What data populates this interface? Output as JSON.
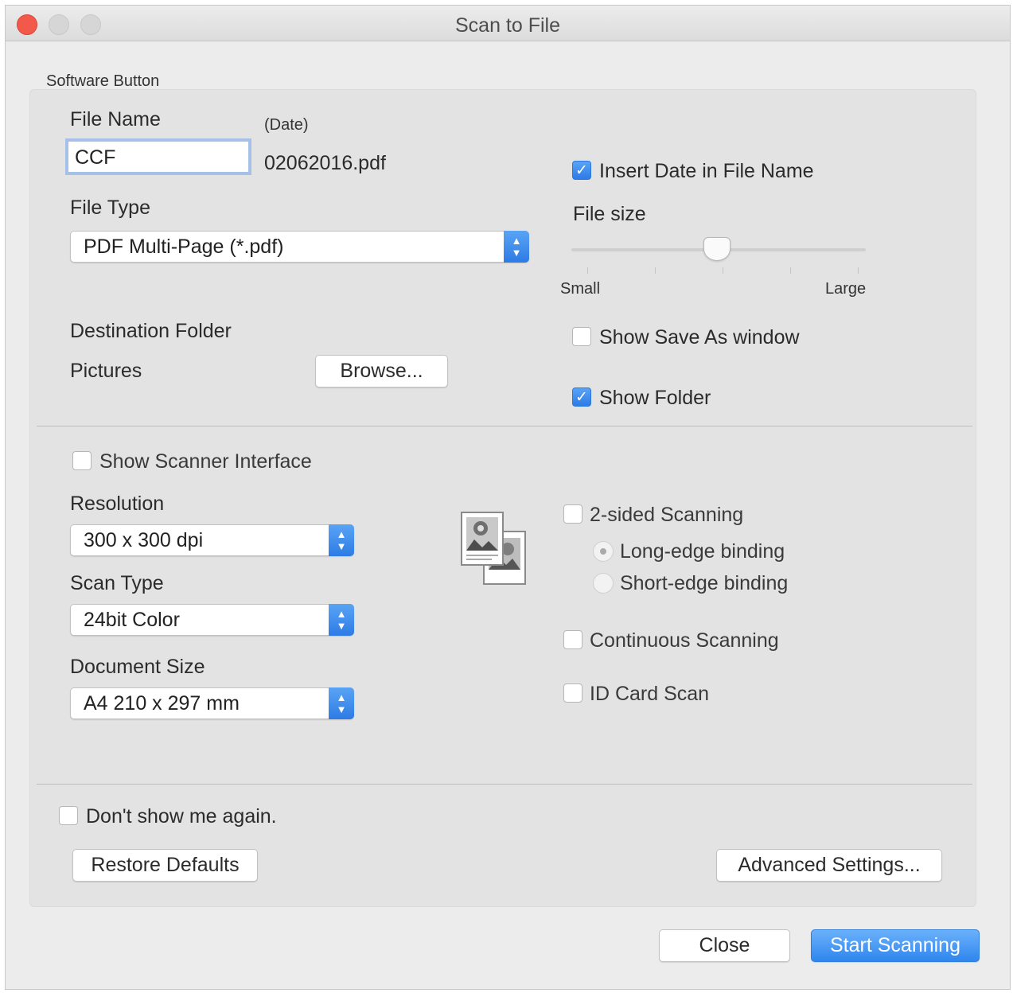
{
  "window": {
    "title": "Scan to File"
  },
  "group": {
    "label": "Software Button"
  },
  "file_name": {
    "label": "File Name",
    "date_label": "(Date)",
    "value": "CCF",
    "suffix": "02062016.pdf"
  },
  "insert_date": {
    "label": "Insert Date in File Name",
    "checked": true
  },
  "file_type": {
    "label": "File Type",
    "selected": "PDF Multi-Page (*.pdf)"
  },
  "file_size": {
    "label": "File size",
    "min_label": "Small",
    "max_label": "Large",
    "level": 0.5
  },
  "destination": {
    "label": "Destination Folder",
    "folder": "Pictures",
    "browse_label": "Browse..."
  },
  "show_save_as": {
    "label": "Show Save As window",
    "checked": false
  },
  "show_folder": {
    "label": "Show Folder",
    "checked": true
  },
  "show_scanner_interface": {
    "label": "Show Scanner Interface",
    "checked": false
  },
  "resolution": {
    "label": "Resolution",
    "selected": "300 x 300 dpi"
  },
  "scan_type": {
    "label": "Scan Type",
    "selected": "24bit Color"
  },
  "document_size": {
    "label": "Document Size",
    "selected": "A4 210 x 297 mm"
  },
  "two_sided": {
    "label": "2-sided Scanning",
    "checked": false,
    "options": [
      {
        "label": "Long-edge binding",
        "selected": true
      },
      {
        "label": "Short-edge binding",
        "selected": false
      }
    ]
  },
  "continuous_scanning": {
    "label": "Continuous Scanning",
    "checked": false
  },
  "id_card_scan": {
    "label": "ID Card Scan",
    "checked": false
  },
  "dont_show": {
    "label": "Don't show me again.",
    "checked": false
  },
  "buttons": {
    "restore_defaults": "Restore Defaults",
    "advanced_settings": "Advanced Settings...",
    "close": "Close",
    "start_scanning": "Start Scanning"
  },
  "icons": {
    "stepper": "up-down-chevrons-icon",
    "checkmark": "✓",
    "scan_preview": "scanned-pages-icon"
  },
  "colors": {
    "accent": "#2d7be5",
    "close_dot": "#f2594a",
    "panel": "#e3e3e3"
  }
}
